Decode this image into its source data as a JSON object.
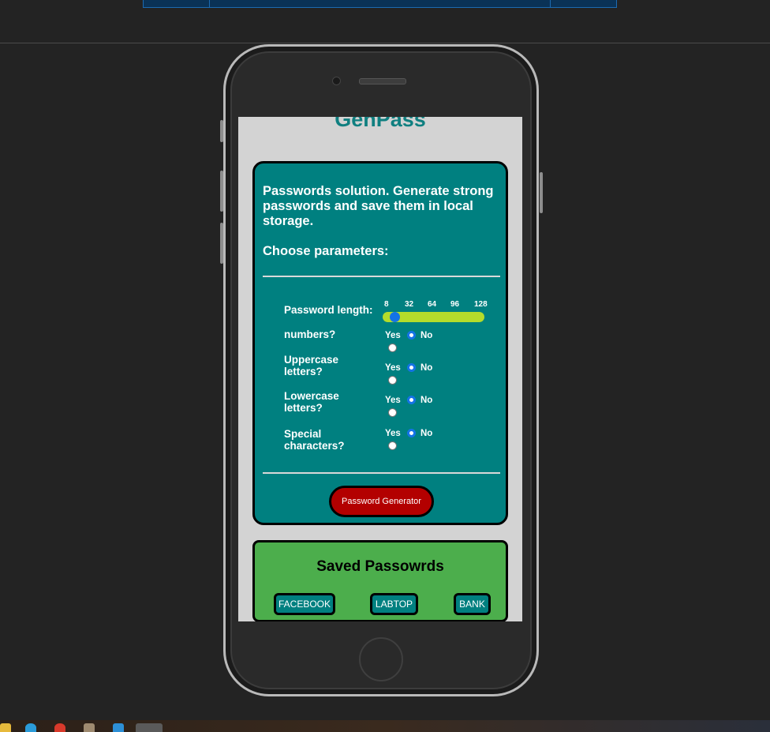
{
  "app": {
    "title": "GenPass"
  },
  "main_card": {
    "intro": "Passwords solution. Generate strong passwords and save them in local storage.",
    "choose_heading": "Choose parameters:",
    "length": {
      "label": "Password length:",
      "ticks": [
        "8",
        "32",
        "64",
        "96",
        "128"
      ],
      "value": 8,
      "min": 8,
      "max": 128
    },
    "options": [
      {
        "label": "numbers?",
        "yes": "Yes",
        "no": "No",
        "selected": "No"
      },
      {
        "label": "Uppercase letters?",
        "yes": "Yes",
        "no": "No",
        "selected": "No"
      },
      {
        "label": "Lowercase letters?",
        "yes": "Yes",
        "no": "No",
        "selected": "No"
      },
      {
        "label": "Special characters?",
        "yes": "Yes",
        "no": "No",
        "selected": "No"
      }
    ],
    "generate_button": "Password Generator"
  },
  "saved": {
    "title": "Saved Passowrds",
    "buttons": [
      "FACEBOOK",
      "LABTOP",
      "BANK"
    ]
  },
  "colors": {
    "teal": "#008080",
    "title_teal": "#0f7f80",
    "saved_green": "#4cae4c",
    "button_red": "#b30000",
    "slider": "#b4dc2b",
    "radio_blue": "#1473e6"
  }
}
